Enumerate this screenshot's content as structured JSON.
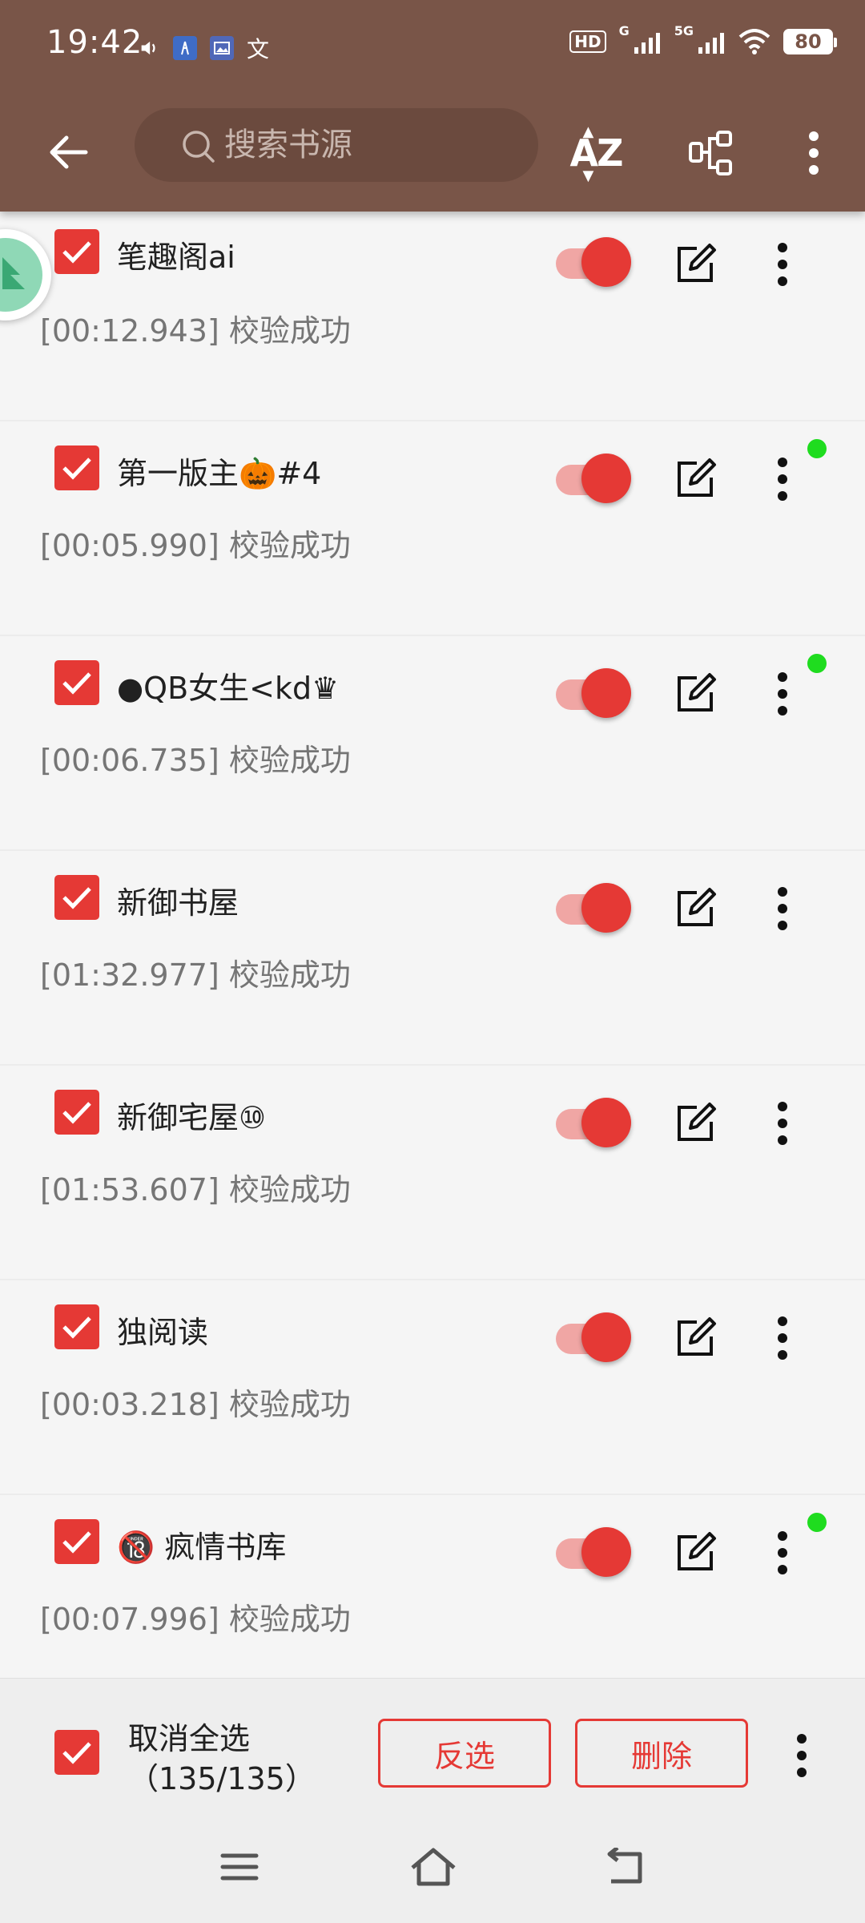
{
  "status_bar": {
    "time": "19:42",
    "left_icons": [
      "volume-icon",
      "app-icon-blue",
      "app-icon-gallery",
      "translate-icon"
    ],
    "translate_glyph": "文",
    "hd_badge": "HD",
    "sim_label": "G",
    "sim2_label": "5G",
    "battery": "80"
  },
  "toolbar": {
    "search_placeholder": "搜索书源",
    "sort_label": "AZ",
    "colors": {
      "primary": "#795548",
      "search_bg": "#6b4a3e"
    }
  },
  "sources": [
    {
      "name": "笔趣阁ai",
      "status": "[00:12.943] 校验成功",
      "checked": true,
      "enabled": true,
      "new_dot": false
    },
    {
      "name": "第一版主🎃#4",
      "status": "[00:05.990] 校验成功",
      "checked": true,
      "enabled": true,
      "new_dot": true
    },
    {
      "name": "●QB女生<kd♛",
      "status": "[00:06.735] 校验成功",
      "checked": true,
      "enabled": true,
      "new_dot": true
    },
    {
      "name": "新御书屋",
      "status": "[01:32.977] 校验成功",
      "checked": true,
      "enabled": true,
      "new_dot": false
    },
    {
      "name": "新御宅屋⑩",
      "status": "[01:53.607] 校验成功",
      "checked": true,
      "enabled": true,
      "new_dot": false
    },
    {
      "name": "独阅读",
      "status": "[00:03.218] 校验成功",
      "checked": true,
      "enabled": true,
      "new_dot": false
    },
    {
      "name": "🔞 疯情书库",
      "status": "[00:07.996] 校验成功",
      "checked": true,
      "enabled": true,
      "new_dot": true
    }
  ],
  "bottom_bar": {
    "select_label": "取消全选",
    "select_count": "（135/135）",
    "invert_label": "反选",
    "delete_label": "删除"
  },
  "accent_color": "#e53935"
}
